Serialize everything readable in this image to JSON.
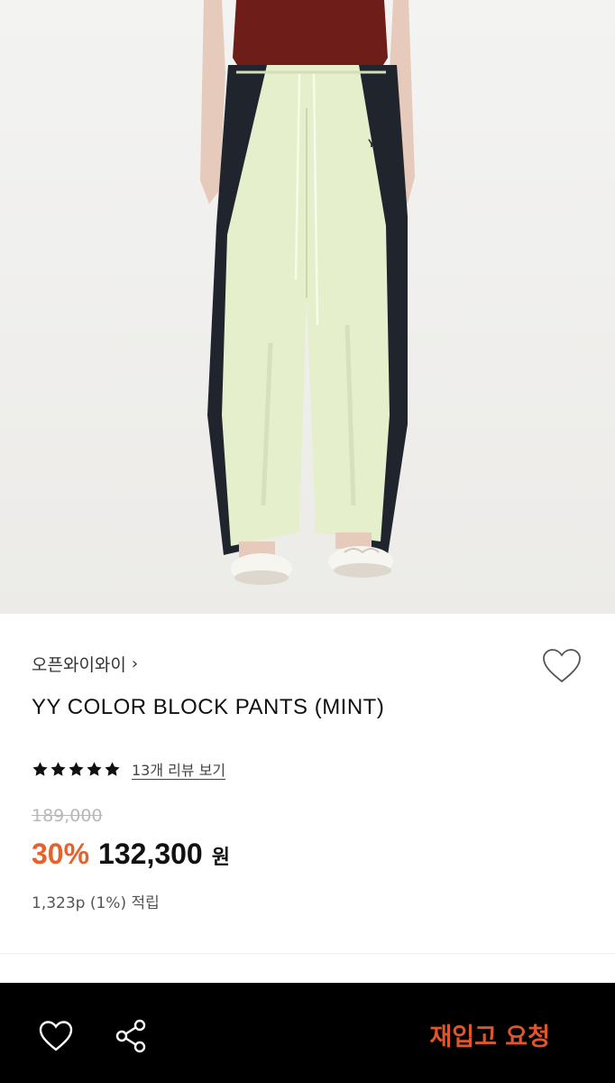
{
  "product": {
    "brand": "오픈와이와이",
    "title": "YY COLOR BLOCK PANTS (MINT)",
    "rating_stars": 5,
    "review_link": "13개 리뷰 보기",
    "original_price": "189,000",
    "discount": "30%",
    "sale_price": "132,300",
    "currency": "원",
    "points": "1,323p (1%) 적립",
    "logo_text": "YY"
  },
  "icons": {
    "brand_chevron": "›",
    "wishlist": "heart-icon",
    "share": "share-icon",
    "star": "star-icon"
  },
  "bottom_bar": {
    "restock_label": "재입고 요청"
  },
  "colors": {
    "accent": "#e5612d",
    "bottom_bar_bg": "#000000",
    "pants_mint": "#e6efcc",
    "pants_stripe": "#20242c",
    "top_maroon": "#6e1d18"
  }
}
